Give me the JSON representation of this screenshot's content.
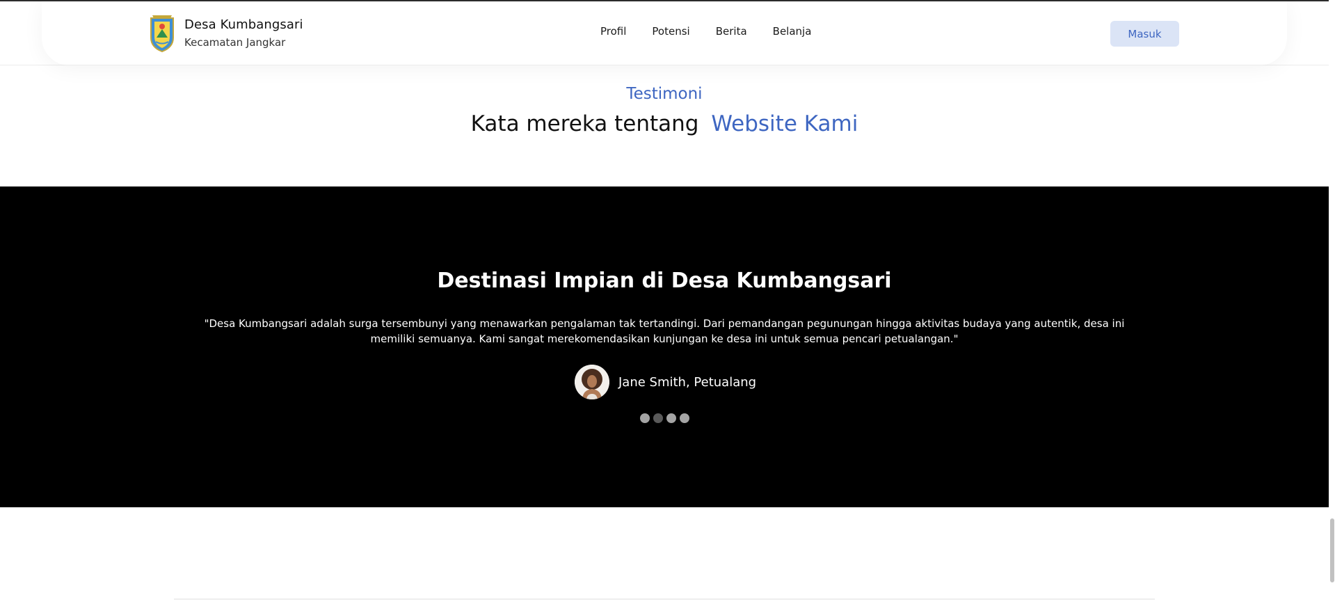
{
  "header": {
    "brand_name": "Desa Kumbangsari",
    "brand_sub": "Kecamatan Jangkar",
    "nav": [
      "Profil",
      "Potensi",
      "Berita",
      "Belanja"
    ],
    "login_label": "Masuk"
  },
  "testimonial_section": {
    "eyebrow": "Testimoni",
    "title_main": "Kata mereka tentang",
    "title_accent": "Website Kami"
  },
  "slide": {
    "title": "Destinasi Impian di Desa Kumbangsari",
    "quote": "\"Desa Kumbangsari adalah surga tersembunyi yang menawarkan pengalaman tak tertandingi. Dari pemandangan pegunungan hingga aktivitas budaya yang autentik, desa ini memiliki semuanya. Kami sangat merekomendasikan kunjungan ke desa ini untuk semua pencari petualangan.\"",
    "author": "Jane Smith, Petualang",
    "dots_total": 4,
    "active_dot": 2
  },
  "colors": {
    "accent": "#3e66c1",
    "button_bg": "#dbe4f6",
    "hero_bg": "#000000"
  }
}
